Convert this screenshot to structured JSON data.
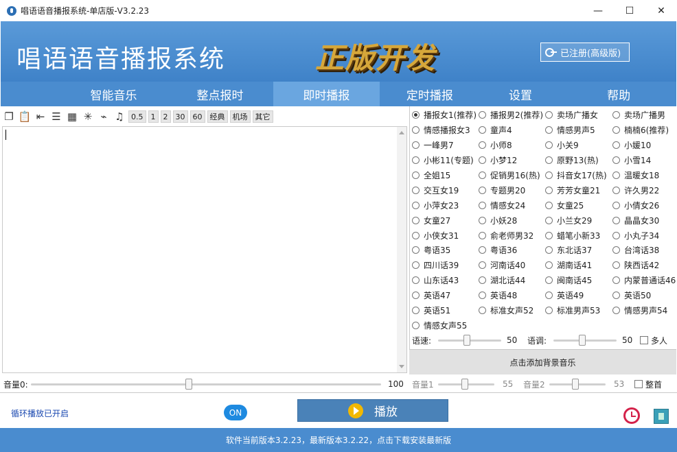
{
  "window": {
    "title": "唱语语音播报系统-单店版-V3.2.23",
    "min_glyph": "—",
    "max_glyph": "☐",
    "close_glyph": "✕"
  },
  "banner": {
    "title": "唱语语音播报系统",
    "logo_text": "正版开发",
    "registration": "已注册(高级版)"
  },
  "nav": {
    "items": [
      {
        "label": "智能音乐",
        "active": false
      },
      {
        "label": "整点报时",
        "active": false
      },
      {
        "label": "即时播报",
        "active": true
      },
      {
        "label": "定时播报",
        "active": false
      },
      {
        "label": "设置",
        "active": false
      },
      {
        "label": "帮助",
        "active": false
      }
    ]
  },
  "toolbar": {
    "icons": [
      "copy-icon",
      "paste-icon",
      "import-icon",
      "list-icon",
      "calculator-icon",
      "sparkle-icon",
      "broom-icon",
      "music-note-icon"
    ],
    "buttons": [
      "0.5",
      "1",
      "2",
      "30",
      "60",
      "经典",
      "机场",
      "其它"
    ]
  },
  "left_volume": {
    "label": "音量0:",
    "value": "100",
    "level_percent": 45
  },
  "voices": [
    "播报女1(推荐)",
    "播报男2(推荐)",
    "卖场广播女",
    "卖场广播男",
    "情感播报女3",
    "童声4",
    "情感男声5",
    "楠楠6(推荐)",
    "一峰男7",
    "小师8",
    "小关9",
    "小媛10",
    "小彬11(专题)",
    "小梦12",
    "原野13(热)",
    "小雪14",
    "全姐15",
    "促销男16(热)",
    "抖音女17(热)",
    "温暖女18",
    "交互女19",
    "专题男20",
    "芳芳女童21",
    "许久男22",
    "小萍女23",
    "情感女24",
    "女童25",
    "小倩女26",
    "女童27",
    "小妖28",
    "小兰女29",
    "晶晶女30",
    "小侠女31",
    "俞老师男32",
    "蜡笔小新33",
    "小丸子34",
    "粤语35",
    "粤语36",
    "东北话37",
    "台湾话38",
    "四川话39",
    "河南话40",
    "湖南话41",
    "陕西话42",
    "山东话43",
    "湖北话44",
    "闽南话45",
    "内蒙普通话46",
    "英语47",
    "英语48",
    "英语49",
    "英语50",
    "英语51",
    "标准女声52",
    "标准男声53",
    "情感男声54",
    "情感女声55"
  ],
  "selected_voice_index": 0,
  "params": {
    "speed_label": "语速:",
    "speed_value": "50",
    "speed_percent": 45,
    "pitch_label": "语调:",
    "pitch_value": "50",
    "pitch_percent": 45,
    "multi_label": "多人"
  },
  "bg_music_label": "点击添加背景音乐",
  "right_volume": {
    "vol1_label": "音量1",
    "vol1_value": "55",
    "vol1_percent": 47,
    "vol2_label": "音量2",
    "vol2_value": "53",
    "vol2_percent": 46,
    "head_label": "整首"
  },
  "bottom": {
    "loop_status": "循环播放已开启",
    "toggle": "ON",
    "play_label": "播放"
  },
  "status": "软件当前版本3.2.23，最新版本3.2.22，点击下载安装最新版",
  "colors": {
    "accent": "#4a8ccf",
    "active_tab": "#6aa6e0",
    "toggle": "#1e8ae0",
    "play": "#4a82b8"
  }
}
